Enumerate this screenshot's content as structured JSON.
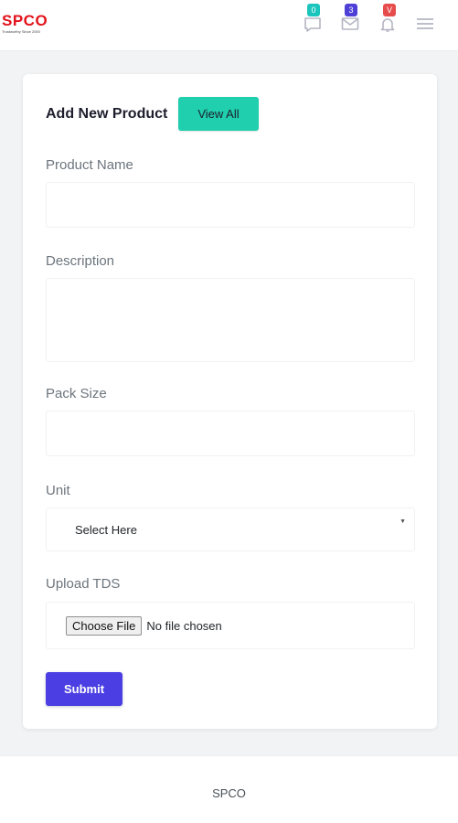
{
  "header": {
    "logo_text": "SPCO",
    "logo_tagline": "Trustworthy Since 2000",
    "chat_badge": "0",
    "mail_badge": "3",
    "notif_badge": "V",
    "colors": {
      "logo": "#e3121a",
      "chat_badge": "#1bc5bd",
      "mail_badge": "#4e3fd6",
      "notif_badge": "#e74c4c"
    }
  },
  "form": {
    "title": "Add New Product",
    "view_all_label": "View All",
    "fields": {
      "product_name": {
        "label": "Product Name",
        "value": ""
      },
      "description": {
        "label": "Description",
        "value": ""
      },
      "pack_size": {
        "label": "Pack Size",
        "value": ""
      },
      "unit": {
        "label": "Unit",
        "selected": "Select Here"
      },
      "upload_tds": {
        "label": "Upload TDS",
        "button_label": "Choose File",
        "status": "No file chosen"
      }
    },
    "submit_label": "Submit",
    "colors": {
      "view_all": "#1fcfae",
      "submit": "#4b3fe3"
    }
  },
  "footer": {
    "text": "SPCO"
  }
}
